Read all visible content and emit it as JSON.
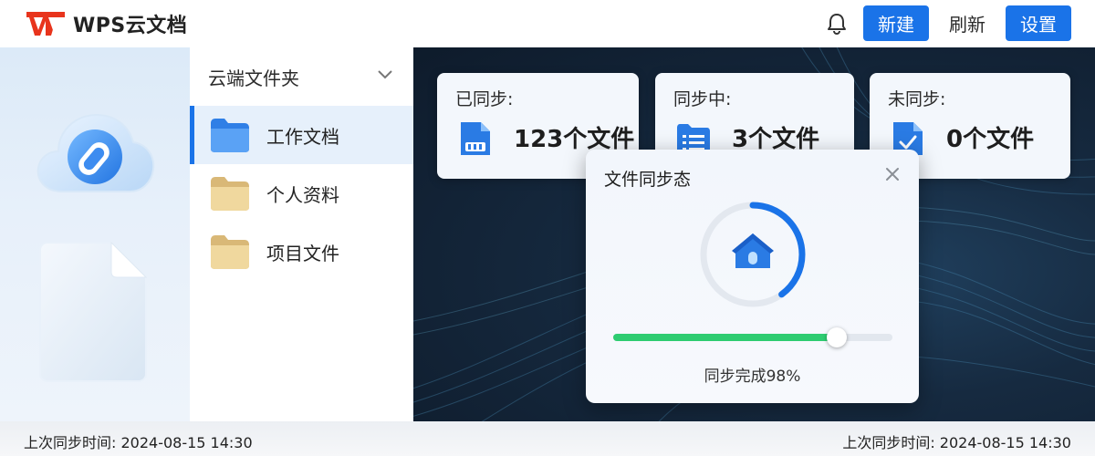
{
  "header": {
    "logo_text": "WPS云文档",
    "buttons": {
      "new": "新建",
      "refresh": "刷新",
      "settings": "设置"
    }
  },
  "colors": {
    "accent": "#1a73e8",
    "progress": "#2ecc71",
    "brand_red": "#e8341c"
  },
  "icons": {
    "logo": "wps-logo-icon",
    "bell": "bell-icon",
    "chevron": "chevron-down-icon",
    "folder": "folder-icon",
    "close": "close-icon",
    "sync_house": "sync-house-icon"
  },
  "sidebar": {
    "header": "云端文件夹",
    "folders": [
      {
        "label": "工作文档",
        "active": true
      },
      {
        "label": "个人资料",
        "active": false
      },
      {
        "label": "项目文件",
        "active": false
      }
    ]
  },
  "stats": [
    {
      "title": "已同步:",
      "value": "123个文件",
      "icon": "document-grid-icon"
    },
    {
      "title": "同步中:",
      "value": "3个文件",
      "icon": "document-list-icon"
    },
    {
      "title": "未同步:",
      "value": "0个文件",
      "icon": "document-check-icon"
    }
  ],
  "dialog": {
    "title": "文件同步态",
    "progress_text": "同步完成98%",
    "slider_fraction": 0.8,
    "ring_fraction": 0.4
  },
  "footer": {
    "left": "上次同步时间: 2024-08-15 14:30",
    "right": "上次同步时间: 2024-08-15 14:30"
  }
}
